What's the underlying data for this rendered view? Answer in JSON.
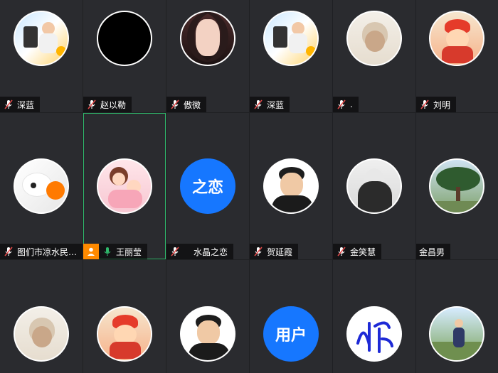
{
  "tiles": [
    {
      "name": "深蓝",
      "avatar": "photo",
      "mic": "muted"
    },
    {
      "name": "赵以勒",
      "avatar": "black",
      "mic": "muted"
    },
    {
      "name": "傲微",
      "avatar": "photo",
      "mic": "muted"
    },
    {
      "name": "深蓝",
      "avatar": "photo",
      "mic": "muted"
    },
    {
      "name": ".",
      "avatar": "photo",
      "mic": "muted"
    },
    {
      "name": "刘明",
      "avatar": "photo",
      "mic": "muted"
    },
    {
      "name": "图们市凉水民…",
      "avatar": "photo",
      "mic": "muted"
    },
    {
      "name": "王丽莹",
      "avatar": "photo",
      "mic": "active",
      "host": true
    },
    {
      "name": "水晶之恋",
      "avatar": "text",
      "avatar_text": "之恋",
      "mic": "muted"
    },
    {
      "name": "贺延霞",
      "avatar": "photo",
      "mic": "muted"
    },
    {
      "name": "金笑慧",
      "avatar": "photo",
      "mic": "muted"
    },
    {
      "name": "金昌男",
      "avatar": "photo",
      "mic": "none"
    },
    {
      "name": "",
      "avatar": "photo",
      "mic": "none"
    },
    {
      "name": "",
      "avatar": "photo",
      "mic": "none"
    },
    {
      "name": "",
      "avatar": "photo",
      "mic": "none"
    },
    {
      "name": "",
      "avatar": "text",
      "avatar_text": "用户",
      "mic": "none"
    },
    {
      "name": "",
      "avatar": "photo",
      "mic": "none"
    },
    {
      "name": "",
      "avatar": "photo",
      "mic": "none"
    }
  ],
  "colors": {
    "background": "#1f2023",
    "tile": "#2a2b2f",
    "active_border": "#2fb96b",
    "mic_muted": "#e34b4b",
    "mic_active": "#2fb96b",
    "host_badge": "#ff8a00",
    "text_avatar": "#1677ff"
  }
}
